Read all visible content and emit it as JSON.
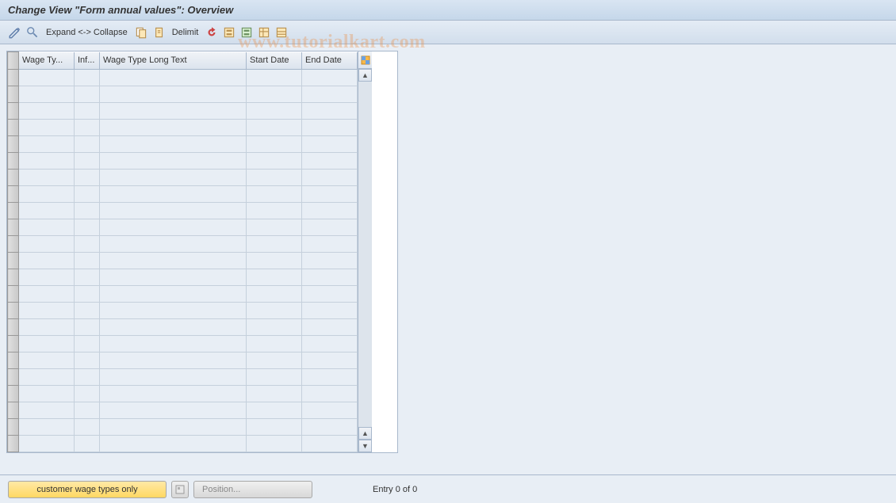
{
  "title": "Change View \"Form annual values\": Overview",
  "toolbar": {
    "expand_label": "Expand <-> Collapse",
    "delimit_label": "Delimit"
  },
  "columns": {
    "c0": "",
    "c1": "Wage Ty...",
    "c2": "Inf...",
    "c3": "Wage Type Long Text",
    "c4": "Start Date",
    "c5": "End Date"
  },
  "row_count": 23,
  "bottom": {
    "customer_btn": "customer wage types only",
    "position_btn": "Position...",
    "entry_status": "Entry 0 of 0"
  },
  "watermark": "www.tutorialkart.com"
}
